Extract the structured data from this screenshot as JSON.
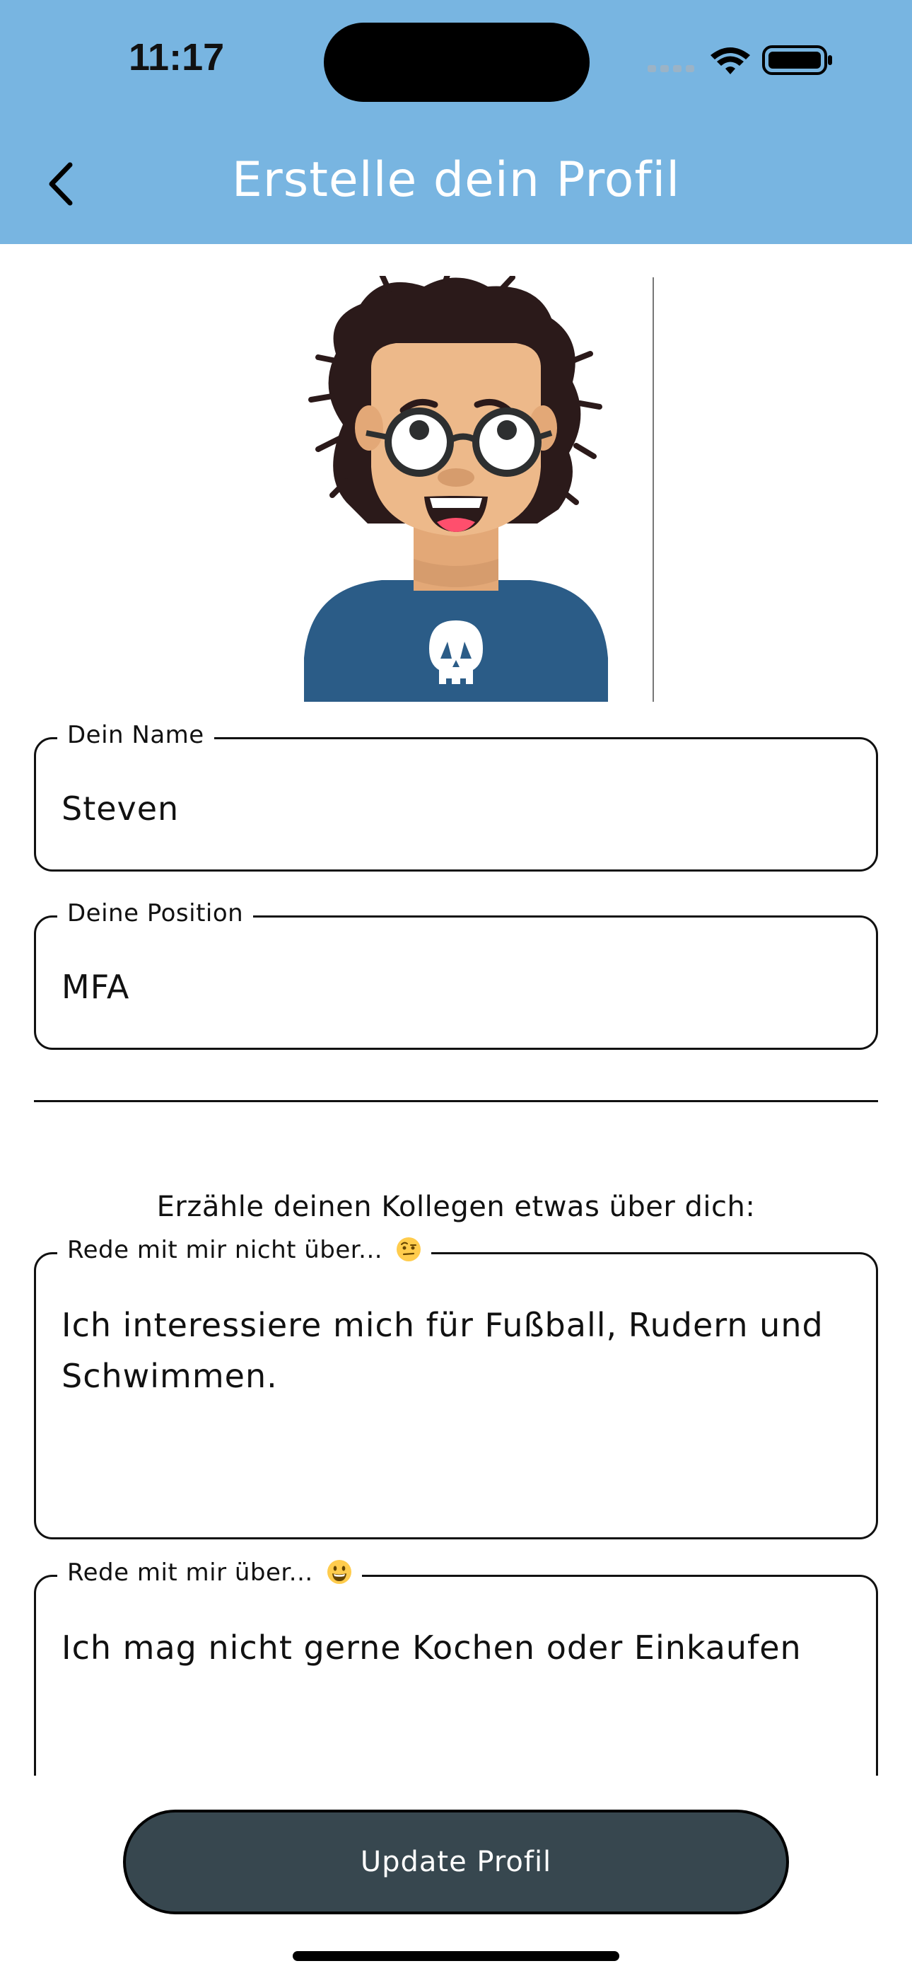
{
  "status_bar": {
    "time": "11:17"
  },
  "header": {
    "title": "Erstelle dein Profil",
    "background": "#78B5E1",
    "back_icon": "chevron-left-icon"
  },
  "form": {
    "name": {
      "label": "Dein Name",
      "value": "Steven"
    },
    "position": {
      "label": "Deine Position",
      "value": "MFA"
    },
    "prompt": "Erzähle deinen Kollegen etwas über dich:",
    "dont_talk": {
      "label": "Rede mit mir nicht über...",
      "emoji": "raised-eyebrow-emoji",
      "value": "Ich interessiere mich für Fußball, Rudern und Schwimmen."
    },
    "talk": {
      "label": "Rede mit mir über...",
      "emoji": "grinning-face-emoji",
      "value": "Ich mag nicht gerne Kochen oder Einkaufen"
    }
  },
  "actions": {
    "update_label": "Update Profil",
    "button_color": "#37474F"
  }
}
